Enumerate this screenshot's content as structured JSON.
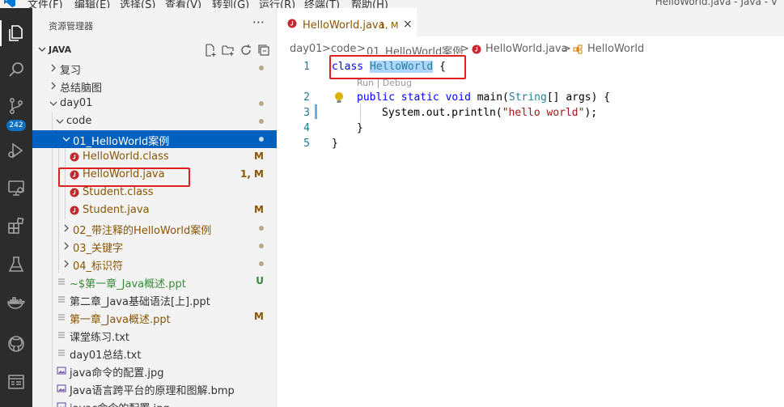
{
  "menubar": {
    "items": [
      "文件(F)",
      "编辑(E)",
      "选择(S)",
      "查看(V)",
      "转到(G)",
      "运行(R)",
      "终端(T)",
      "帮助(H)"
    ],
    "title": "HelloWorld.java - Java - V"
  },
  "activitybar": {
    "items": [
      "explorer-icon",
      "search-icon",
      "source-control-icon",
      "run-debug-icon",
      "remote-explorer-icon",
      "extensions-icon",
      "testing-icon",
      "docker-icon",
      "github-icon",
      "terminal-panel-icon"
    ],
    "scm_badge": "242"
  },
  "sidebar": {
    "header": "资源管理器",
    "more": "···",
    "section_title": "JAVA",
    "tree": [
      {
        "name": "复习",
        "type": "folder",
        "open": false,
        "level": 0,
        "deco": "dot"
      },
      {
        "name": "总结脑图",
        "type": "folder",
        "open": false,
        "level": 0,
        "deco": ""
      },
      {
        "name": "day01",
        "type": "folder",
        "open": true,
        "level": 0,
        "deco": "dot"
      },
      {
        "name": "code",
        "type": "folder",
        "open": true,
        "level": 1,
        "deco": "dot"
      },
      {
        "name": "01_HelloWorld案例",
        "type": "folder",
        "open": true,
        "level": 2,
        "deco": "dot",
        "selected": true
      },
      {
        "name": "HelloWorld.class",
        "type": "java",
        "level": 3,
        "deco": "M",
        "status": "mod"
      },
      {
        "name": "HelloWorld.java",
        "type": "java",
        "level": 3,
        "deco": "1, M",
        "status": "mod"
      },
      {
        "name": "Student.class",
        "type": "java",
        "level": 3,
        "deco": "",
        "status": "mod"
      },
      {
        "name": "Student.java",
        "type": "java",
        "level": 3,
        "deco": "M",
        "status": "mod"
      },
      {
        "name": "02_带注释的HelloWorld案例",
        "type": "folder",
        "open": false,
        "level": 2,
        "deco": "dot",
        "status": "mod"
      },
      {
        "name": "03_关键字",
        "type": "folder",
        "open": false,
        "level": 2,
        "deco": "dot",
        "status": "mod"
      },
      {
        "name": "04_标识符",
        "type": "folder",
        "open": false,
        "level": 2,
        "deco": "dot",
        "status": "mod"
      },
      {
        "name": "~$第一章_Java概述.ppt",
        "type": "file",
        "level": 1,
        "deco": "U",
        "status": "untracked"
      },
      {
        "name": "第二章_Java基础语法[上].ppt",
        "type": "file",
        "level": 1,
        "deco": "",
        "status": ""
      },
      {
        "name": "第一章_Java概述.ppt",
        "type": "file",
        "level": 1,
        "deco": "M",
        "status": "mod"
      },
      {
        "name": "课堂练习.txt",
        "type": "file",
        "level": 1,
        "deco": "",
        "status": ""
      },
      {
        "name": "day01总结.txt",
        "type": "file",
        "level": 1,
        "deco": "",
        "status": ""
      },
      {
        "name": "java命令的配置.jpg",
        "type": "image",
        "level": 1,
        "deco": "",
        "status": ""
      },
      {
        "name": "Java语言跨平台的原理和图解.bmp",
        "type": "image",
        "level": 1,
        "deco": "",
        "status": ""
      },
      {
        "name": "javac命令的配置.jpg",
        "type": "image",
        "level": 1,
        "deco": "",
        "status": ""
      }
    ]
  },
  "tab": {
    "name": "HelloWorld.java",
    "meta": "1, M",
    "close": "×"
  },
  "breadcrumb": [
    "day01",
    ">",
    "code",
    ">",
    "01_HelloWorld案例",
    ">",
    "HelloWorld.java",
    ">",
    "HelloWorld"
  ],
  "editor": {
    "line_numbers": [
      "1",
      "2",
      "3",
      "4",
      "5"
    ],
    "codelens": "Run | Debug",
    "line1": {
      "kw": "class",
      "cls": "HelloWorld",
      "rest": " {"
    },
    "line2": {
      "kw1": "public",
      "kw2": "static",
      "kw3": "void",
      "fn": "main(",
      "ty": "String",
      "rest": "[] args) {"
    },
    "line3": {
      "pre": "System.out.println(",
      "str": "\"hello world\"",
      "post": ");"
    },
    "line4": "}",
    "line5": "}"
  },
  "colors": {
    "accent": "#0060c0",
    "highlight_box": "#e02020",
    "modified": "#895503",
    "untracked": "#388a34"
  }
}
